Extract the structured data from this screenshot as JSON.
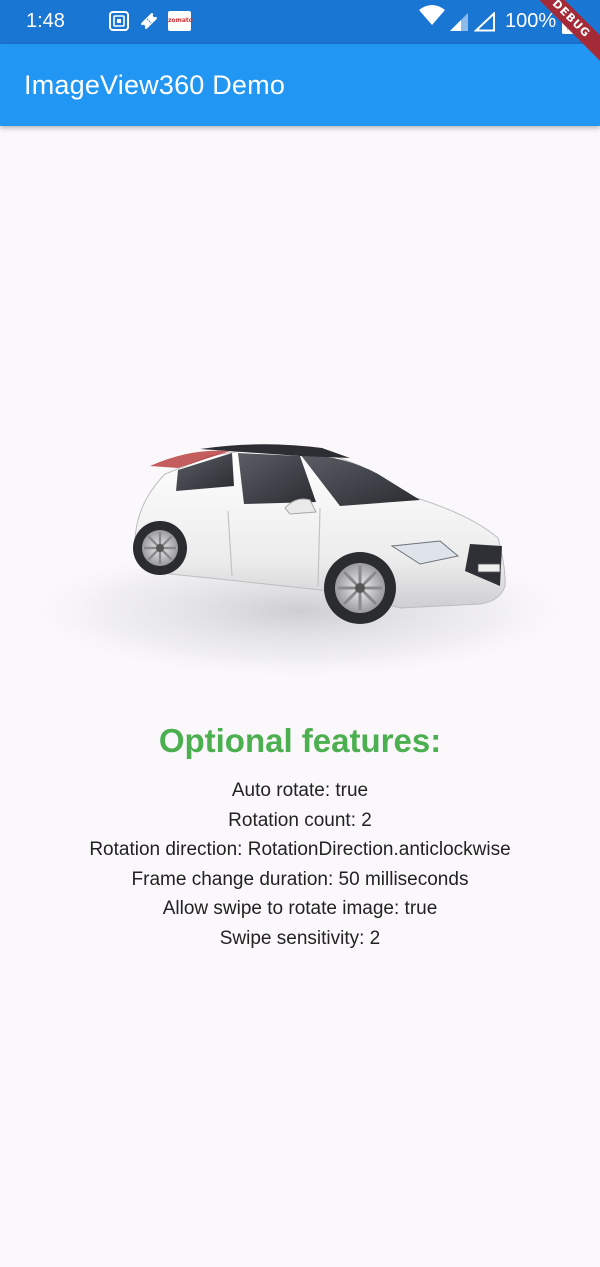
{
  "status_bar": {
    "time": "1:48",
    "notification_icons": [
      "calendar-app-icon",
      "ticket-app-icon",
      "zomato-app-icon"
    ],
    "zomato_label": "zomato",
    "battery": "100%",
    "color": "#1976d2"
  },
  "debug_banner": "DEBUG",
  "app_bar": {
    "title": "ImageView360 Demo",
    "color": "#2196f3"
  },
  "image_view": {
    "subject": "white-hatchback-car-image"
  },
  "features": {
    "title": "Optional features:",
    "title_color": "#4caf50",
    "items": [
      "Auto rotate: true",
      "Rotation count: 2",
      "Rotation direction: RotationDirection.anticlockwise",
      "Frame change duration: 50 milliseconds",
      "Allow swipe to rotate image: true",
      "Swipe sensitivity: 2"
    ]
  }
}
